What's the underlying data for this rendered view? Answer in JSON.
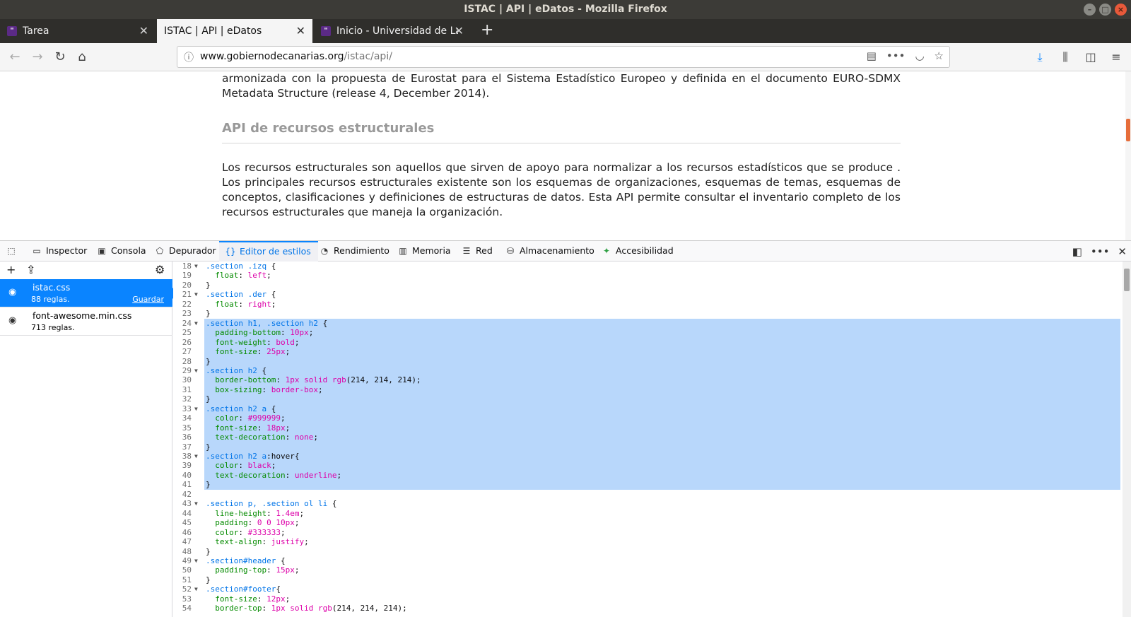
{
  "window": {
    "title": "ISTAC | API | eDatos - Mozilla Firefox"
  },
  "tabs": [
    {
      "title": "Tarea"
    },
    {
      "title": "ISTAC | API | eDatos"
    },
    {
      "title": "Inicio - Universidad de La"
    }
  ],
  "url": {
    "domain": "www.gobiernodecanarias.org",
    "path": "/istac/api/"
  },
  "page": {
    "para1": "armonizada con la propuesta de Eurostat para el Sistema Estadístico Europeo y definida en el documento EURO-SDMX Metadata Structure (release 4, December 2014).",
    "heading": "API de recursos estructurales",
    "para2": "Los recursos estructurales son aquellos que sirven de apoyo para normalizar a los recursos estadísticos que se produce . Los principales recursos estructurales existente son los esquemas de organizaciones, esquemas de temas, esquemas de conceptos, clasificaciones y definiciones de estructuras de datos. Esta API permite consultar el inventario completo de los recursos estructurales que maneja la organización."
  },
  "devtools": {
    "tabs": [
      {
        "label": "Inspector",
        "icon": "inspector-icon"
      },
      {
        "label": "Consola",
        "icon": "console-icon"
      },
      {
        "label": "Depurador",
        "icon": "debugger-icon"
      },
      {
        "label": "Editor de estilos",
        "icon": "style-editor-icon"
      },
      {
        "label": "Rendimiento",
        "icon": "performance-icon"
      },
      {
        "label": "Memoria",
        "icon": "memory-icon"
      },
      {
        "label": "Red",
        "icon": "network-icon"
      },
      {
        "label": "Almacenamiento",
        "icon": "storage-icon"
      },
      {
        "label": "Accesibilidad",
        "icon": "accessibility-icon"
      }
    ],
    "stylesheets": [
      {
        "name": "istac.css",
        "rules": "88 reglas.",
        "save": "Guardar"
      },
      {
        "name": "font-awesome.min.css",
        "rules": "713 reglas."
      }
    ]
  },
  "code": [
    {
      "n": "18",
      "fold": true,
      "tokens": [
        [
          ".section .izq ",
          "sel"
        ],
        [
          "{",
          "punc"
        ]
      ]
    },
    {
      "n": "19",
      "tokens": [
        [
          "  ",
          "punc"
        ],
        [
          "float",
          "prop"
        ],
        [
          ": ",
          "punc"
        ],
        [
          "left",
          "val"
        ],
        [
          ";",
          "punc"
        ]
      ]
    },
    {
      "n": "20",
      "tokens": [
        [
          "}",
          "punc"
        ]
      ]
    },
    {
      "n": "21",
      "fold": true,
      "tokens": [
        [
          ".section .der ",
          "sel"
        ],
        [
          "{",
          "punc"
        ]
      ]
    },
    {
      "n": "22",
      "tokens": [
        [
          "  ",
          "punc"
        ],
        [
          "float",
          "prop"
        ],
        [
          ": ",
          "punc"
        ],
        [
          "right",
          "val"
        ],
        [
          ";",
          "punc"
        ]
      ]
    },
    {
      "n": "23",
      "tokens": [
        [
          "}",
          "punc"
        ]
      ]
    },
    {
      "n": "24",
      "fold": true,
      "sel": true,
      "tokens": [
        [
          ".section h1, .section h2 ",
          "sel"
        ],
        [
          "{",
          "punc"
        ]
      ]
    },
    {
      "n": "25",
      "sel": true,
      "tokens": [
        [
          "  ",
          "punc"
        ],
        [
          "padding-bottom",
          "prop"
        ],
        [
          ": ",
          "punc"
        ],
        [
          "10px",
          "val"
        ],
        [
          ";",
          "punc"
        ]
      ]
    },
    {
      "n": "26",
      "sel": true,
      "tokens": [
        [
          "  ",
          "punc"
        ],
        [
          "font-weight",
          "prop"
        ],
        [
          ": ",
          "punc"
        ],
        [
          "bold",
          "val"
        ],
        [
          ";",
          "punc"
        ]
      ]
    },
    {
      "n": "27",
      "sel": true,
      "tokens": [
        [
          "  ",
          "punc"
        ],
        [
          "font-size",
          "prop"
        ],
        [
          ": ",
          "punc"
        ],
        [
          "25px",
          "val"
        ],
        [
          ";",
          "punc"
        ]
      ]
    },
    {
      "n": "28",
      "sel": true,
      "tokens": [
        [
          "}",
          "punc"
        ]
      ]
    },
    {
      "n": "29",
      "fold": true,
      "sel": true,
      "tokens": [
        [
          ".section h2 ",
          "sel"
        ],
        [
          "{",
          "punc"
        ]
      ]
    },
    {
      "n": "30",
      "sel": true,
      "tokens": [
        [
          "  ",
          "punc"
        ],
        [
          "border-bottom",
          "prop"
        ],
        [
          ": ",
          "punc"
        ],
        [
          "1px solid rgb",
          "val"
        ],
        [
          "(214, 214, 214);",
          "punc"
        ]
      ]
    },
    {
      "n": "31",
      "sel": true,
      "tokens": [
        [
          "  ",
          "punc"
        ],
        [
          "box-sizing",
          "prop"
        ],
        [
          ": ",
          "punc"
        ],
        [
          "border-box",
          "val"
        ],
        [
          ";",
          "punc"
        ]
      ]
    },
    {
      "n": "32",
      "sel": true,
      "tokens": [
        [
          "}",
          "punc"
        ]
      ]
    },
    {
      "n": "33",
      "fold": true,
      "sel": true,
      "tokens": [
        [
          ".section h2 a ",
          "sel"
        ],
        [
          "{",
          "punc"
        ]
      ]
    },
    {
      "n": "34",
      "sel": true,
      "tokens": [
        [
          "  ",
          "punc"
        ],
        [
          "color",
          "prop"
        ],
        [
          ": ",
          "punc"
        ],
        [
          "#999999",
          "val"
        ],
        [
          ";",
          "punc"
        ]
      ]
    },
    {
      "n": "35",
      "sel": true,
      "tokens": [
        [
          "  ",
          "punc"
        ],
        [
          "font-size",
          "prop"
        ],
        [
          ": ",
          "punc"
        ],
        [
          "18px",
          "val"
        ],
        [
          ";",
          "punc"
        ]
      ]
    },
    {
      "n": "36",
      "sel": true,
      "tokens": [
        [
          "  ",
          "punc"
        ],
        [
          "text-decoration",
          "prop"
        ],
        [
          ": ",
          "punc"
        ],
        [
          "none",
          "val"
        ],
        [
          ";",
          "punc"
        ]
      ]
    },
    {
      "n": "37",
      "sel": true,
      "tokens": [
        [
          "}",
          "punc"
        ]
      ]
    },
    {
      "n": "38",
      "fold": true,
      "sel": true,
      "tokens": [
        [
          ".section h2 a",
          "sel"
        ],
        [
          ":hover{",
          "punc"
        ]
      ]
    },
    {
      "n": "39",
      "sel": true,
      "tokens": [
        [
          "  ",
          "punc"
        ],
        [
          "color",
          "prop"
        ],
        [
          ": ",
          "punc"
        ],
        [
          "black",
          "val"
        ],
        [
          ";",
          "punc"
        ]
      ]
    },
    {
      "n": "40",
      "sel": true,
      "tokens": [
        [
          "  ",
          "punc"
        ],
        [
          "text-decoration",
          "prop"
        ],
        [
          ": ",
          "punc"
        ],
        [
          "underline",
          "val"
        ],
        [
          ";",
          "punc"
        ]
      ]
    },
    {
      "n": "41",
      "sel": true,
      "tokens": [
        [
          "}",
          "punc"
        ]
      ]
    },
    {
      "n": "42",
      "tokens": []
    },
    {
      "n": "43",
      "fold": true,
      "tokens": [
        [
          ".section p, .section ol li ",
          "sel"
        ],
        [
          "{",
          "punc"
        ]
      ]
    },
    {
      "n": "44",
      "tokens": [
        [
          "  ",
          "punc"
        ],
        [
          "line-height",
          "prop"
        ],
        [
          ": ",
          "punc"
        ],
        [
          "1.4em",
          "val"
        ],
        [
          ";",
          "punc"
        ]
      ]
    },
    {
      "n": "45",
      "tokens": [
        [
          "  ",
          "punc"
        ],
        [
          "padding",
          "prop"
        ],
        [
          ": ",
          "punc"
        ],
        [
          "0 0 10px",
          "val"
        ],
        [
          ";",
          "punc"
        ]
      ]
    },
    {
      "n": "46",
      "tokens": [
        [
          "  ",
          "punc"
        ],
        [
          "color",
          "prop"
        ],
        [
          ": ",
          "punc"
        ],
        [
          "#333333",
          "val"
        ],
        [
          ";",
          "punc"
        ]
      ]
    },
    {
      "n": "47",
      "tokens": [
        [
          "  ",
          "punc"
        ],
        [
          "text-align",
          "prop"
        ],
        [
          ": ",
          "punc"
        ],
        [
          "justify",
          "val"
        ],
        [
          ";",
          "punc"
        ]
      ]
    },
    {
      "n": "48",
      "tokens": [
        [
          "}",
          "punc"
        ]
      ]
    },
    {
      "n": "49",
      "fold": true,
      "tokens": [
        [
          ".section#header ",
          "sel"
        ],
        [
          "{",
          "punc"
        ]
      ]
    },
    {
      "n": "50",
      "tokens": [
        [
          "  ",
          "punc"
        ],
        [
          "padding-top",
          "prop"
        ],
        [
          ": ",
          "punc"
        ],
        [
          "15px",
          "val"
        ],
        [
          ";",
          "punc"
        ]
      ]
    },
    {
      "n": "51",
      "tokens": [
        [
          "}",
          "punc"
        ]
      ]
    },
    {
      "n": "52",
      "fold": true,
      "tokens": [
        [
          ".section#footer",
          "sel"
        ],
        [
          "{",
          "punc"
        ]
      ]
    },
    {
      "n": "53",
      "tokens": [
        [
          "  ",
          "punc"
        ],
        [
          "font-size",
          "prop"
        ],
        [
          ": ",
          "punc"
        ],
        [
          "12px",
          "val"
        ],
        [
          ";",
          "punc"
        ]
      ]
    },
    {
      "n": "54",
      "tokens": [
        [
          "  ",
          "punc"
        ],
        [
          "border-top",
          "prop"
        ],
        [
          ": ",
          "punc"
        ],
        [
          "1px solid rgb",
          "val"
        ],
        [
          "(214, 214, 214);",
          "punc"
        ]
      ]
    }
  ]
}
